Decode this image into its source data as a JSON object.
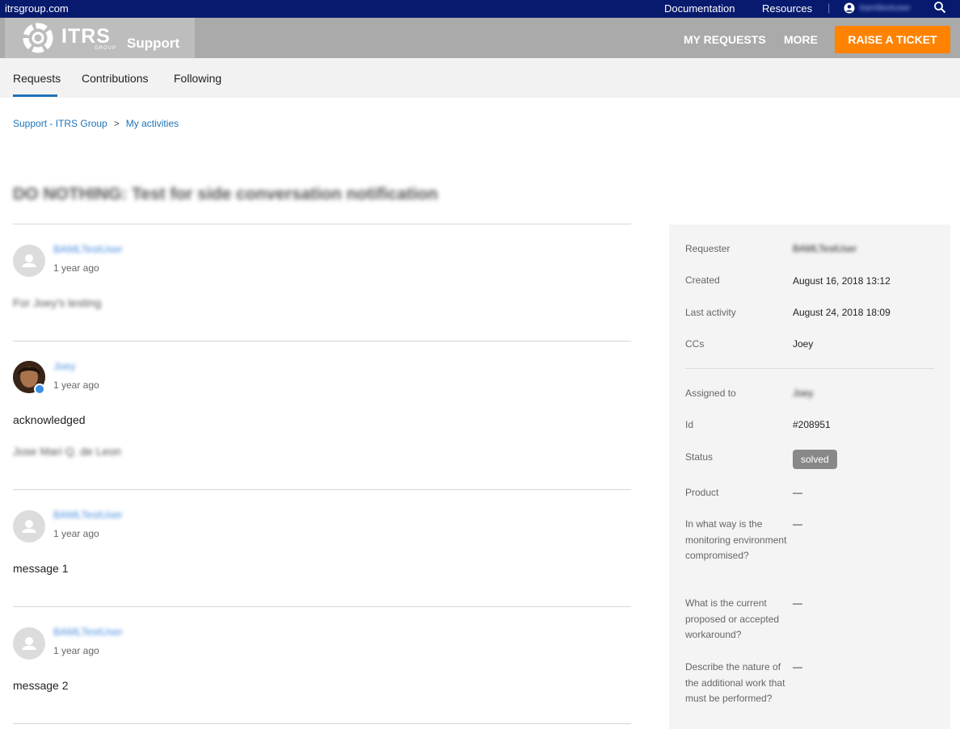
{
  "topbar": {
    "site": "itrsgroup.com",
    "links": [
      "Documentation",
      "Resources"
    ],
    "username": "bamltestuser"
  },
  "header": {
    "logo_text": "ITRS",
    "logo_sub": "GROUP",
    "brand_label": "Support",
    "nav": [
      "MY REQUESTS",
      "MORE"
    ],
    "cta": "RAISE A TICKET",
    "accent_color": "#ff8200",
    "topbar_color": "#071a6e"
  },
  "subnav": {
    "tabs": [
      "Requests",
      "Contributions",
      "Following"
    ],
    "active": "Requests"
  },
  "breadcrumb": [
    "Support - ITRS Group",
    "My activities"
  ],
  "request": {
    "title": "DO NOTHING: Test for side conversation notification"
  },
  "comments": [
    {
      "author": "BAMLTestUser",
      "time": "1 year ago",
      "lines": [
        "For Joey's testing"
      ]
    },
    {
      "author": "Joey",
      "time": "1 year ago",
      "lines": [
        "acknowledged",
        "Jose Mari Q. de Leon"
      ]
    },
    {
      "author": "BAMLTestUser",
      "time": "1 year ago",
      "lines": [
        "message 1"
      ]
    },
    {
      "author": "BAMLTestUser",
      "time": "1 year ago",
      "lines": [
        "message 2"
      ]
    }
  ],
  "details": {
    "requester_label": "Requester",
    "requester": "BAMLTestUser",
    "created_label": "Created",
    "created": "August 16, 2018 13:12",
    "last_activity_label": "Last activity",
    "last_activity": "August 24, 2018 18:09",
    "ccs_label": "CCs",
    "ccs": "Joey",
    "assigned_label": "Assigned to",
    "assigned": "Joey",
    "id_label": "Id",
    "id": "#208951",
    "status_label": "Status",
    "status": "solved",
    "product_label": "Product",
    "product": "—",
    "q1_label": "In what way is the monitoring environment compromised?",
    "q1": "—",
    "q2_label": "What is the current proposed or accepted workaround?",
    "q2": "—",
    "q3_label": "Describe the nature of the additional work that must be performed?",
    "q3": "—"
  }
}
